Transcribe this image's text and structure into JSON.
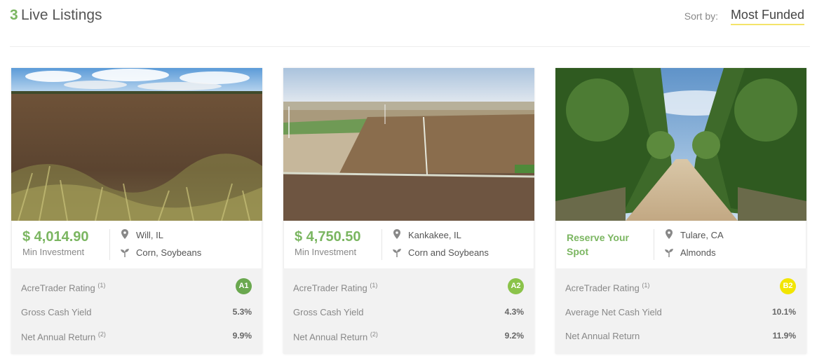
{
  "header": {
    "count": "3",
    "title": "Live Listings",
    "sort_label": "Sort by:",
    "sort_value": "Most Funded"
  },
  "colors": {
    "accent_green": "#7bb661",
    "sort_underline": "#f4e46a",
    "badge_a1": "#6aa84f",
    "badge_a2": "#8bc34a",
    "badge_b2": "#f2e500"
  },
  "listings": [
    {
      "image": "farm-field-photo",
      "price": "$ 4,014.90",
      "price_label": "Min Investment",
      "location": "Will, IL",
      "crops": "Corn, Soybeans",
      "rating_label": "AcreTrader Rating",
      "rating_note": "(1)",
      "rating": "A1",
      "yield_label": "Gross Cash Yield",
      "yield_value": "5.3%",
      "return_label": "Net Annual Return",
      "return_note": "(2)",
      "return_value": "9.9%"
    },
    {
      "image": "aerial-farmland-photo",
      "price": "$ 4,750.50",
      "price_label": "Min Investment",
      "location": "Kankakee, IL",
      "crops": "Corn and Soybeans",
      "rating_label": "AcreTrader Rating",
      "rating_note": "(1)",
      "rating": "A2",
      "yield_label": "Gross Cash Yield",
      "yield_value": "4.3%",
      "return_label": "Net Annual Return",
      "return_note": "(2)",
      "return_value": "9.2%"
    },
    {
      "image": "almond-orchard-photo",
      "reserve": "Reserve Your Spot",
      "location": "Tulare, CA",
      "crops": "Almonds",
      "rating_label": "AcreTrader Rating",
      "rating_note": "(1)",
      "rating": "B2",
      "yield_label": "Average Net Cash Yield",
      "yield_value": "10.1%",
      "return_label": "Net Annual Return",
      "return_value": "11.9%"
    }
  ]
}
